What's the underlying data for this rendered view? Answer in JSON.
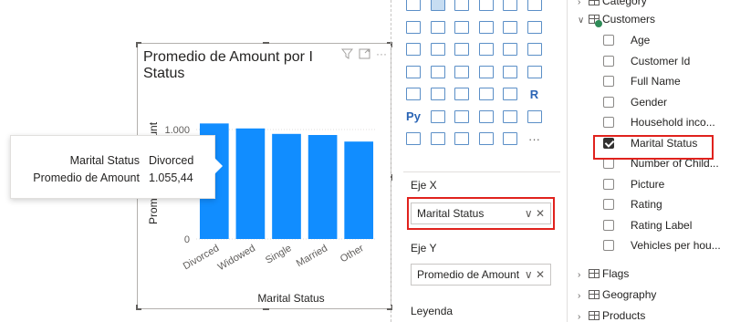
{
  "visual": {
    "title": "Promedio de Amount por Marital Status",
    "title_line1": "Promedio de Amount por I",
    "title_line2": "Status",
    "header_icons": [
      "filter-icon",
      "focus-mode-icon",
      "more-options-icon"
    ],
    "more_glyph": "···"
  },
  "tooltip": {
    "rows": [
      {
        "key": "Marital Status",
        "value": "Divorced"
      },
      {
        "key": "Promedio de Amount",
        "value": "1.055,44"
      }
    ]
  },
  "chart_data": {
    "type": "bar",
    "title": "Promedio de Amount por Marital Status",
    "categories": [
      "Divorced",
      "Widowed",
      "Single",
      "Married",
      "Other"
    ],
    "values": [
      1055.44,
      1010,
      960,
      950,
      890
    ],
    "xlabel": "Marital Status",
    "ylabel": "Promedio de Amount",
    "ylabel_visible": "Prom",
    "ylabel_visible_2": "ount",
    "ylim": [
      0,
      1200
    ],
    "yticks": [
      0,
      1000
    ],
    "ytick_labels": [
      "0",
      "1.000"
    ],
    "bar_color": "#118dff",
    "grid": true
  },
  "viz_pane": {
    "x_axis_label": "Eje X",
    "x_axis_field": "Marital Status",
    "y_axis_label": "Eje Y",
    "y_axis_field": "Promedio de Amount",
    "legend_label": "Leyenda",
    "well_controls": "∨ ✕",
    "visual_icons": [
      "stacked-bar-icon",
      "clustered-bar-icon",
      "stacked-bar-100-icon",
      "stacked-column-icon",
      "clustered-column-icon",
      "stacked-column-100-icon",
      "line-chart-icon",
      "area-chart-icon",
      "stacked-area-icon",
      "line-column-icon",
      "line-clustered-column-icon",
      "ribbon-chart-icon",
      "waterfall-icon",
      "funnel-icon",
      "scatter-icon",
      "pie-chart-icon",
      "donut-chart-icon",
      "treemap-icon",
      "map-icon",
      "filled-map-icon",
      "shape-map-icon",
      "azure-map-icon",
      "gauge-icon",
      "card-icon",
      "multi-row-card-icon",
      "kpi-icon",
      "slicer-icon",
      "table-icon",
      "matrix-icon",
      "r-visual-icon",
      "python-visual-icon",
      "key-influencers-icon",
      "decomposition-tree-icon",
      "qna-icon",
      "narrative-icon",
      "goals-icon",
      "paginated-report-icon",
      "power-apps-icon",
      "power-automate-icon",
      "arcgis-icon",
      "sigma-icon",
      "more-visuals-icon"
    ],
    "r_glyph": "R",
    "py_glyph": "Py",
    "more_glyph": "···"
  },
  "fields_pane": {
    "category_label": "Category",
    "customers_label": "Customers",
    "customers_fields": [
      {
        "name": "Age",
        "checked": false
      },
      {
        "name": "Customer Id",
        "checked": false
      },
      {
        "name": "Full Name",
        "checked": false
      },
      {
        "name": "Gender",
        "checked": false
      },
      {
        "name": "Household inco...",
        "checked": false
      },
      {
        "name": "Marital Status",
        "checked": true
      },
      {
        "name": "Number of Child...",
        "checked": false
      },
      {
        "name": "Picture",
        "checked": false
      },
      {
        "name": "Rating",
        "checked": false
      },
      {
        "name": "Rating Label",
        "checked": false
      },
      {
        "name": "Vehicles per hou...",
        "checked": false
      }
    ],
    "tables": [
      {
        "name": "Flags"
      },
      {
        "name": "Geography"
      },
      {
        "name": "Products"
      }
    ],
    "highlight_color": "#e0221d"
  }
}
